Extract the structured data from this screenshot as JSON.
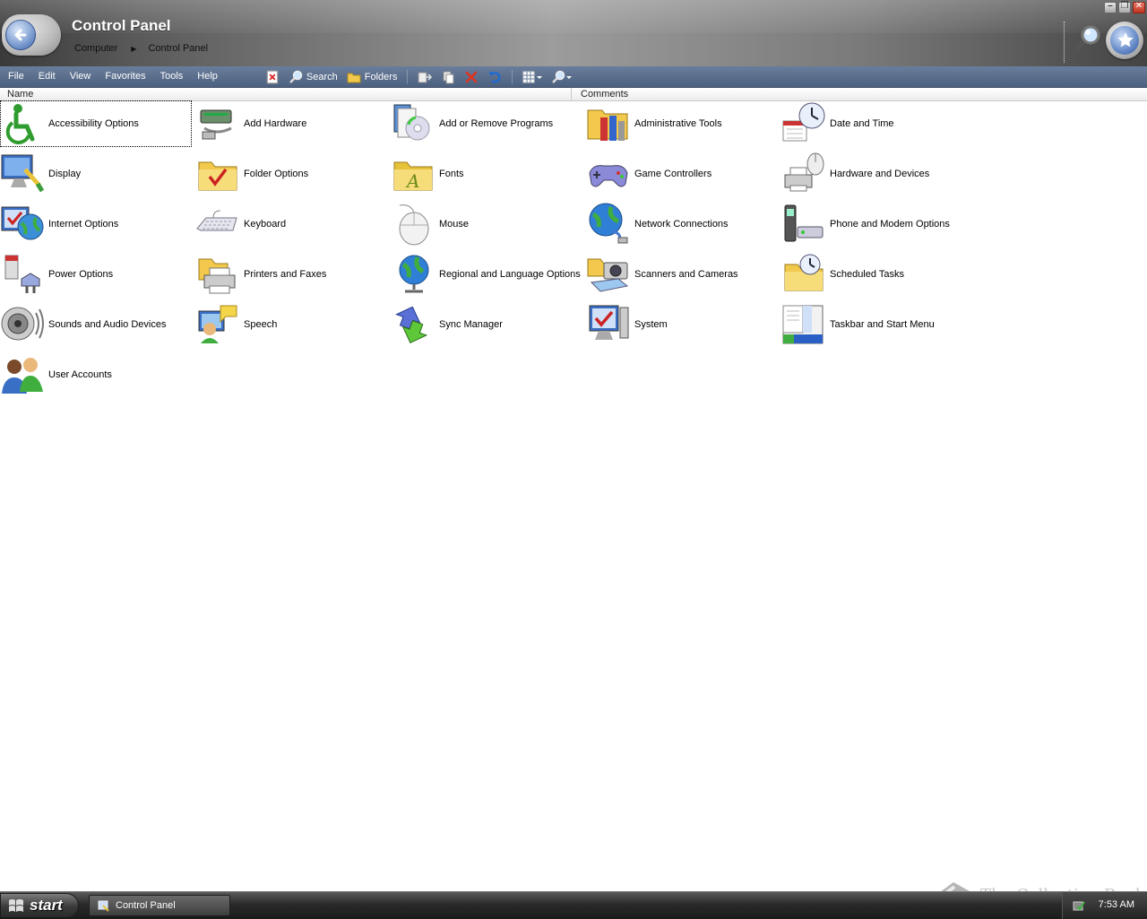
{
  "window": {
    "title": "Control Panel",
    "breadcrumb": [
      "Computer",
      "Control Panel"
    ]
  },
  "menu": [
    "File",
    "Edit",
    "View",
    "Favorites",
    "Tools",
    "Help"
  ],
  "toolbar": {
    "search_label": "Search",
    "folders_label": "Folders"
  },
  "columns": {
    "name": "Name",
    "comments": "Comments"
  },
  "items": [
    {
      "label": "Accessibility Options",
      "icon": "accessibility-icon"
    },
    {
      "label": "Add Hardware",
      "icon": "add-hardware-icon"
    },
    {
      "label": "Add or Remove Programs",
      "icon": "add-remove-programs-icon"
    },
    {
      "label": "Administrative Tools",
      "icon": "administrative-tools-icon"
    },
    {
      "label": "Date and Time",
      "icon": "date-time-icon"
    },
    {
      "label": "Display",
      "icon": "display-icon"
    },
    {
      "label": "Folder Options",
      "icon": "folder-options-icon"
    },
    {
      "label": "Fonts",
      "icon": "fonts-icon"
    },
    {
      "label": "Game Controllers",
      "icon": "game-controllers-icon"
    },
    {
      "label": "Hardware and Devices",
      "icon": "hardware-devices-icon"
    },
    {
      "label": "Internet Options",
      "icon": "internet-options-icon"
    },
    {
      "label": "Keyboard",
      "icon": "keyboard-icon"
    },
    {
      "label": "Mouse",
      "icon": "mouse-icon"
    },
    {
      "label": "Network Connections",
      "icon": "network-connections-icon"
    },
    {
      "label": "Phone and Modem Options",
      "icon": "phone-modem-icon"
    },
    {
      "label": "Power Options",
      "icon": "power-options-icon"
    },
    {
      "label": "Printers and Faxes",
      "icon": "printers-faxes-icon"
    },
    {
      "label": "Regional and Language Options",
      "icon": "regional-language-icon"
    },
    {
      "label": "Scanners and Cameras",
      "icon": "scanners-cameras-icon"
    },
    {
      "label": "Scheduled Tasks",
      "icon": "scheduled-tasks-icon"
    },
    {
      "label": "Sounds and Audio Devices",
      "icon": "sounds-audio-icon"
    },
    {
      "label": "Speech",
      "icon": "speech-icon"
    },
    {
      "label": "Sync Manager",
      "icon": "sync-manager-icon"
    },
    {
      "label": "System",
      "icon": "system-icon"
    },
    {
      "label": "Taskbar and Start Menu",
      "icon": "taskbar-start-menu-icon"
    },
    {
      "label": "User Accounts",
      "icon": "user-accounts-icon"
    }
  ],
  "taskbar": {
    "start_label": "start",
    "task_label": "Control Panel",
    "clock": "7:53 AM"
  },
  "watermark": "The Collection Book"
}
